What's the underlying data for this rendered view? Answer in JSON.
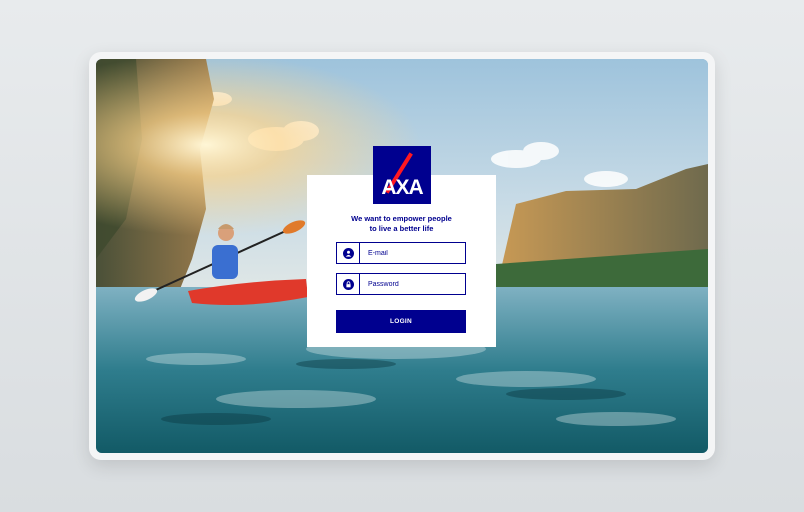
{
  "brand": {
    "logo_text": "AXA",
    "primary_color": "#00008f",
    "accent_color": "#ff1721"
  },
  "login": {
    "tagline_line1": "We want to empower people",
    "tagline_line2": "to live a better life",
    "email_placeholder": "E-mail",
    "password_placeholder": "Password",
    "login_label": "LOGIN"
  },
  "icons": {
    "email": "user-icon",
    "password": "lock-icon"
  }
}
